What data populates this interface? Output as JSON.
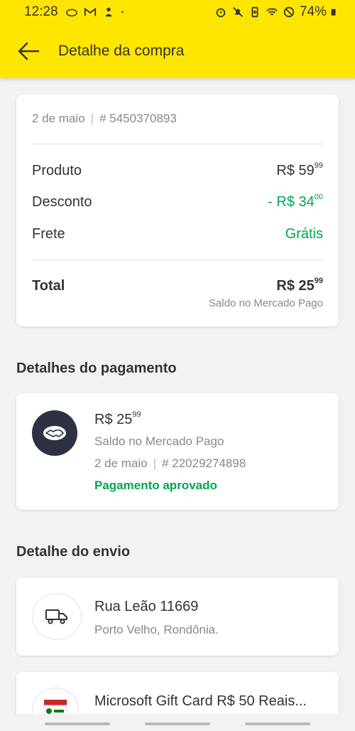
{
  "status_bar": {
    "time": "12:28",
    "battery": "74%",
    "left_icons": [
      "cloud-icon",
      "gmail-icon",
      "notification-icon",
      "dot-icon"
    ],
    "right_icons": [
      "alarm-icon",
      "mute-icon",
      "battery-saver-icon",
      "wifi-icon",
      "dnd-icon",
      "battery-icon"
    ]
  },
  "app_bar": {
    "title": "Detalhe da compra",
    "back_icon": "arrow-left-icon"
  },
  "summary": {
    "date": "2 de maio",
    "separator": "|",
    "order_number": "# 5450370893",
    "rows": [
      {
        "label": "Produto",
        "value": "R$ 59",
        "cents": "99"
      },
      {
        "label": "Desconto",
        "value": "- R$ 34",
        "cents": "00"
      },
      {
        "label": "Frete",
        "value": "Grátis"
      }
    ],
    "total": {
      "label": "Total",
      "value": "R$ 25",
      "cents": "99"
    },
    "paid_with": "Saldo no Mercado Pago"
  },
  "payment_section": {
    "title": "Detalhes do pagamento",
    "amount": "R$ 25",
    "amount_cents": "99",
    "method": "Saldo no Mercado Pago",
    "date": "2 de maio",
    "separator": "|",
    "transaction": "# 22029274898",
    "status": "Pagamento aprovado",
    "icon": "handshake-icon"
  },
  "shipping_section": {
    "title": "Detalhe do envio",
    "street": "Rua Leão 11669",
    "city": "Porto Velho, Rondônia.",
    "icon": "truck-icon"
  },
  "product": {
    "title": "Microsoft Gift Card R$ 50 Reais..."
  },
  "colors": {
    "brand_yellow": "#ffe600",
    "success_green": "#00a650",
    "dark_avatar": "#2d3243"
  }
}
